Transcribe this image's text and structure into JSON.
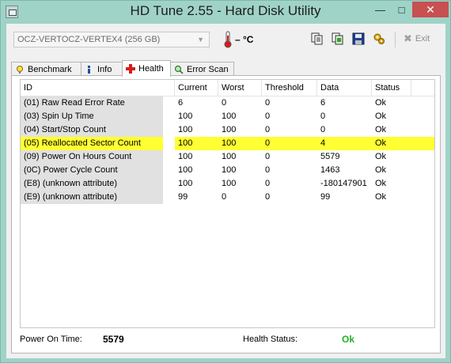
{
  "window": {
    "title": "HD Tune 2.55 - Hard Disk Utility",
    "minimize": "—",
    "maximize": "□",
    "close": "✕"
  },
  "toolbar": {
    "drive": "OCZ-VERTOCZ-VERTEX4 (256 GB)",
    "temperature": "– °C",
    "exit_label": "Exit",
    "icons": [
      "copy-text-icon",
      "copy-screenshot-icon",
      "save-icon",
      "options-icon"
    ]
  },
  "tabs": [
    {
      "label": "Benchmark",
      "icon": "benchmark-icon",
      "active": false
    },
    {
      "label": "Info",
      "icon": "info-icon",
      "active": false
    },
    {
      "label": "Health",
      "icon": "health-cross-icon",
      "active": true
    },
    {
      "label": "Error Scan",
      "icon": "magnifier-icon",
      "active": false
    }
  ],
  "health": {
    "columns": [
      "ID",
      "Current",
      "Worst",
      "Threshold",
      "Data",
      "Status"
    ],
    "rows": [
      {
        "id": "(01) Raw Read Error Rate",
        "current": "6",
        "worst": "0",
        "threshold": "0",
        "data": "6",
        "status": "Ok",
        "highlight": false
      },
      {
        "id": "(03) Spin Up Time",
        "current": "100",
        "worst": "100",
        "threshold": "0",
        "data": "0",
        "status": "Ok",
        "highlight": false
      },
      {
        "id": "(04) Start/Stop Count",
        "current": "100",
        "worst": "100",
        "threshold": "0",
        "data": "0",
        "status": "Ok",
        "highlight": false
      },
      {
        "id": "(05) Reallocated Sector Count",
        "current": "100",
        "worst": "100",
        "threshold": "0",
        "data": "4",
        "status": "Ok",
        "highlight": true
      },
      {
        "id": "(09) Power On Hours Count",
        "current": "100",
        "worst": "100",
        "threshold": "0",
        "data": "5579",
        "status": "Ok",
        "highlight": false
      },
      {
        "id": "(0C) Power Cycle Count",
        "current": "100",
        "worst": "100",
        "threshold": "0",
        "data": "1463",
        "status": "Ok",
        "highlight": false
      },
      {
        "id": "(E8) (unknown attribute)",
        "current": "100",
        "worst": "100",
        "threshold": "0",
        "data": "-180147901",
        "status": "Ok",
        "highlight": false
      },
      {
        "id": "(E9) (unknown attribute)",
        "current": "99",
        "worst": "0",
        "threshold": "0",
        "data": "99",
        "status": "Ok",
        "highlight": false
      }
    ],
    "highlight_color": "#ffff33"
  },
  "footer": {
    "power_on_label": "Power On Time:",
    "power_on_value": "5579",
    "health_label": "Health Status:",
    "health_value": "Ok",
    "ok_color": "#22b322"
  }
}
